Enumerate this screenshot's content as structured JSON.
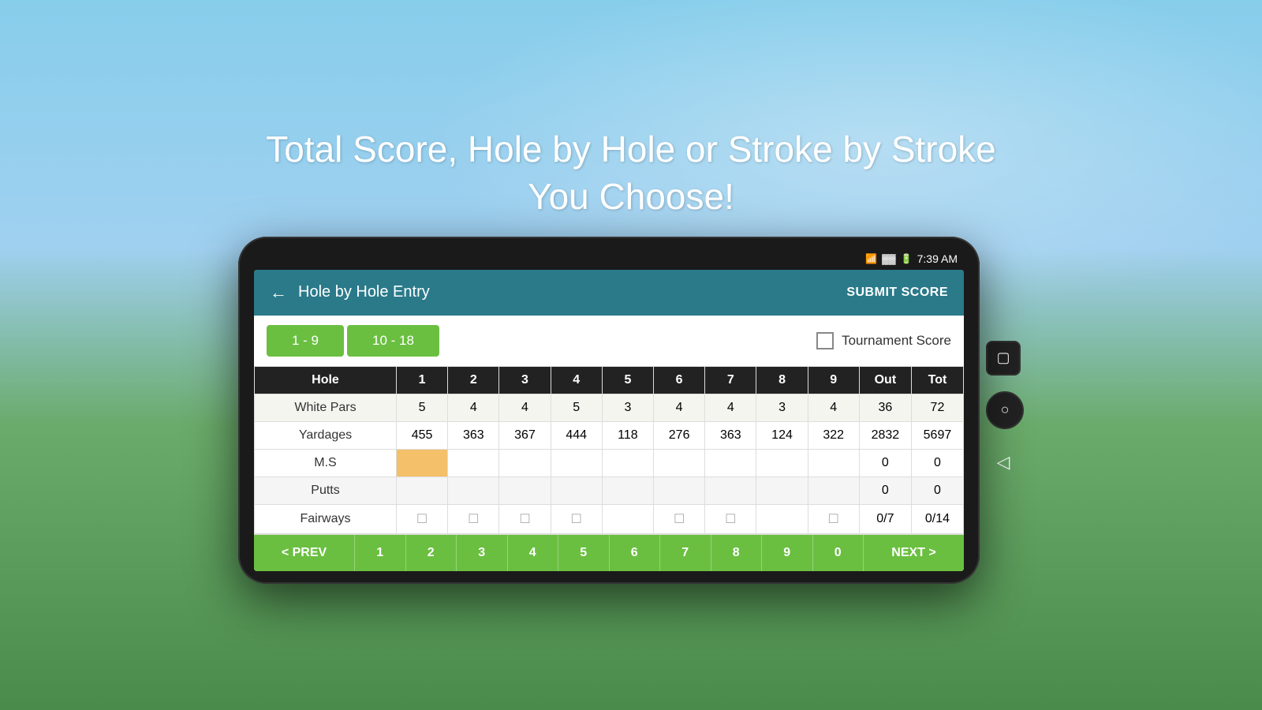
{
  "headline": {
    "line1": "Total Score, Hole by Hole or Stroke by Stroke",
    "line2": "You Choose!"
  },
  "device": {
    "status_bar": {
      "time": "7:39 AM",
      "wifi": "wifi",
      "signal": "signal",
      "battery": "battery"
    }
  },
  "app": {
    "header": {
      "back_arrow": "←",
      "title": "Hole by Hole Entry",
      "submit_button": "SUBMIT SCORE"
    },
    "tabs": {
      "tab1_label": "1 - 9",
      "tab2_label": "10 - 18",
      "tournament_label": "Tournament Score"
    },
    "table": {
      "headers": [
        "Hole",
        "1",
        "2",
        "3",
        "4",
        "5",
        "6",
        "7",
        "8",
        "9",
        "Out",
        "Tot"
      ],
      "rows": [
        {
          "label": "White Pars",
          "values": [
            "5",
            "4",
            "4",
            "5",
            "3",
            "4",
            "4",
            "3",
            "4",
            "36",
            "72"
          ]
        },
        {
          "label": "Yardages",
          "values": [
            "455",
            "363",
            "367",
            "444",
            "118",
            "276",
            "363",
            "124",
            "322",
            "2832",
            "5697"
          ]
        },
        {
          "label": "M.S",
          "values": [
            "",
            "",
            "",
            "",
            "",
            "",
            "",
            "",
            "",
            "0",
            "0"
          ],
          "highlight_col": 0
        },
        {
          "label": "Putts",
          "values": [
            "",
            "",
            "",
            "",
            "",
            "",
            "",
            "",
            "",
            "0",
            "0"
          ]
        },
        {
          "label": "Fairways",
          "values": [
            "☐",
            "☐",
            "☐",
            "☐",
            "",
            "☐",
            "☐",
            "",
            "☐",
            "0/7",
            "0/14"
          ],
          "is_fairways": true
        }
      ]
    },
    "nav_buttons": [
      "< PREV",
      "1",
      "2",
      "3",
      "4",
      "5",
      "6",
      "7",
      "8",
      "9",
      "0",
      "NEXT >"
    ]
  },
  "side_buttons": {
    "square_icon": "▢",
    "circle_icon": "○",
    "back_icon": "◁"
  }
}
